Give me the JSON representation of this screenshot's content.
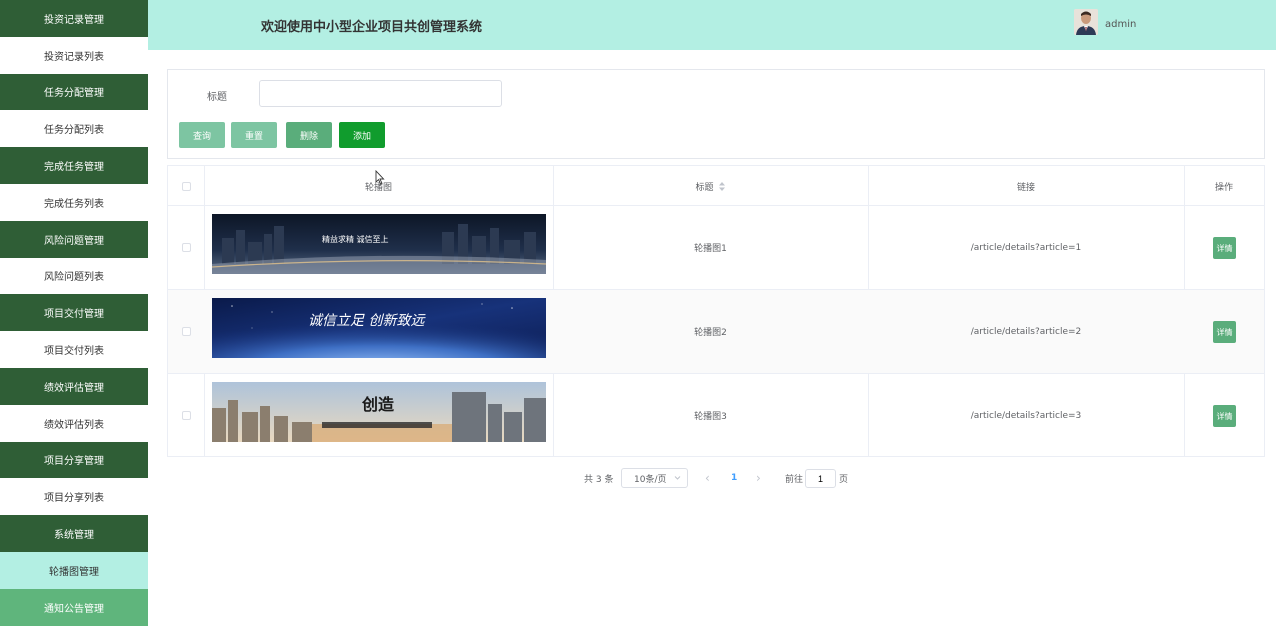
{
  "header": {
    "title": "欢迎使用中小型企业项目共创管理系统",
    "username": "admin"
  },
  "sidebar": {
    "items": [
      {
        "label": "投资记录管理",
        "type": "group"
      },
      {
        "label": "投资记录列表",
        "type": "sub"
      },
      {
        "label": "任务分配管理",
        "type": "group"
      },
      {
        "label": "任务分配列表",
        "type": "sub"
      },
      {
        "label": "完成任务管理",
        "type": "group"
      },
      {
        "label": "完成任务列表",
        "type": "sub"
      },
      {
        "label": "风险问题管理",
        "type": "group"
      },
      {
        "label": "风险问题列表",
        "type": "sub"
      },
      {
        "label": "项目交付管理",
        "type": "group"
      },
      {
        "label": "项目交付列表",
        "type": "sub"
      },
      {
        "label": "绩效评估管理",
        "type": "group"
      },
      {
        "label": "绩效评估列表",
        "type": "sub"
      },
      {
        "label": "项目分享管理",
        "type": "group"
      },
      {
        "label": "项目分享列表",
        "type": "sub"
      },
      {
        "label": "系统管理",
        "type": "group"
      },
      {
        "label": "轮播图管理",
        "type": "active"
      },
      {
        "label": "通知公告管理",
        "type": "bottom"
      }
    ]
  },
  "search": {
    "title_label": "标题",
    "title_value": ""
  },
  "buttons": {
    "query": "查询",
    "reset": "重置",
    "delete": "删除",
    "add": "添加"
  },
  "table": {
    "headers": {
      "image": "轮播图",
      "title": "标题",
      "link": "链接",
      "action": "操作"
    },
    "sort_icon": "sort-icon",
    "rows": [
      {
        "title": "轮播图1",
        "link": "/article/details?article=1",
        "action": "详情",
        "banner_text": "精益求精 诚信至上"
      },
      {
        "title": "轮播图2",
        "link": "/article/details?article=2",
        "action": "详情",
        "banner_text": "诚信立足 创新致远"
      },
      {
        "title": "轮播图3",
        "link": "/article/details?article=3",
        "action": "详情",
        "banner_text": "创造"
      }
    ]
  },
  "pagination": {
    "total": "共 3 条",
    "page_size": "10条/页",
    "prev": "‹",
    "current": "1",
    "next": "›",
    "goto_label": "前往",
    "goto_value": "1",
    "page_suffix": "页"
  },
  "colors": {
    "sidebar_group": "#2f5e36",
    "header_bg": "#b3efe3",
    "add_button": "#109c2d",
    "active_page": "#409eff"
  }
}
